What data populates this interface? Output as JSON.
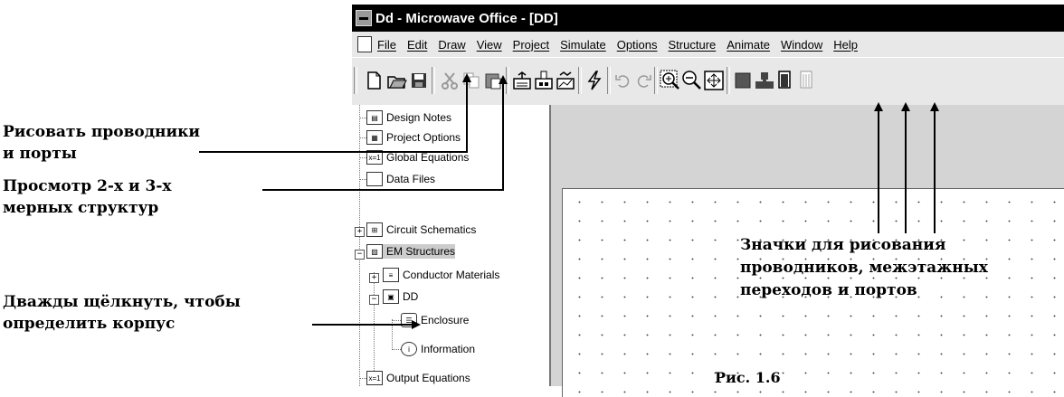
{
  "window": {
    "title": "Dd - Microwave Office - [DD]"
  },
  "menu": [
    "File",
    "Edit",
    "Draw",
    "View",
    "Project",
    "Simulate",
    "Options",
    "Structure",
    "Animate",
    "Window",
    "Help"
  ],
  "tree": {
    "items": [
      {
        "label": "Design Notes",
        "icon": "notes-icon"
      },
      {
        "label": "Project Options",
        "icon": "options-icon"
      },
      {
        "label": "Global Equations",
        "icon": "equations-icon"
      },
      {
        "label": "Data Files",
        "icon": "folder-icon"
      },
      {
        "label": "Circuit Schematics",
        "icon": "schematic-icon"
      },
      {
        "label": "EM Structures",
        "icon": "em-icon"
      },
      {
        "label": "Conductor Materials",
        "icon": "materials-icon"
      },
      {
        "label": "DD",
        "icon": "structure-icon"
      },
      {
        "label": "Enclosure",
        "icon": "enclosure-icon"
      },
      {
        "label": "Information",
        "icon": "info-icon"
      },
      {
        "label": "Output Equations",
        "icon": "equations-icon"
      }
    ]
  },
  "annotations": {
    "draw_ports": [
      "Рисовать проводники",
      "и порты"
    ],
    "view_structs": [
      "Просмотр 2-х и 3-х",
      "мерных структур"
    ],
    "enclosure": [
      "Дважды щёлкнуть, чтобы",
      "определить корпус"
    ],
    "icons": [
      "Значки для рисования",
      "проводников, межэтажных",
      "переходов и портов"
    ]
  },
  "caption": "Рис. 1.6"
}
